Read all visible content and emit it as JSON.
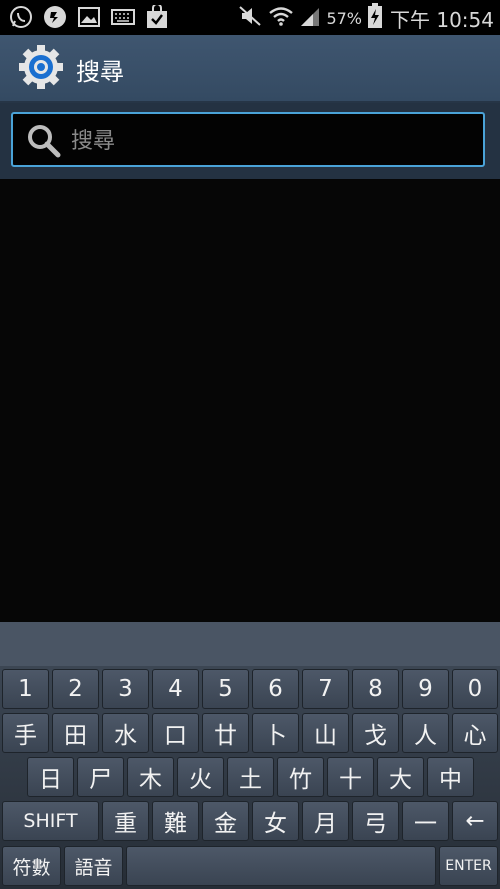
{
  "status_bar": {
    "icons": [
      "whatsapp-icon",
      "sync-icon",
      "gallery-icon",
      "keyboard-icon",
      "store-bag-icon"
    ],
    "right_icons": [
      "mute-icon",
      "wifi-icon",
      "signal-icon",
      "battery-charging-icon"
    ],
    "battery_percent": "57%",
    "time": "下午 10:54"
  },
  "action_bar": {
    "icon": "settings-gear-icon",
    "title": "搜尋"
  },
  "search": {
    "placeholder": "搜尋",
    "value": "",
    "icon": "search-icon"
  },
  "keyboard": {
    "row_numbers": [
      "1",
      "2",
      "3",
      "4",
      "5",
      "6",
      "7",
      "8",
      "9",
      "0"
    ],
    "row_1": [
      "手",
      "田",
      "水",
      "口",
      "廿",
      "卜",
      "山",
      "戈",
      "人",
      "心"
    ],
    "row_2": [
      "日",
      "尸",
      "木",
      "火",
      "土",
      "竹",
      "十",
      "大",
      "中"
    ],
    "row_3": [
      "SHIFT",
      "重",
      "難",
      "金",
      "女",
      "月",
      "弓",
      "一",
      "←"
    ],
    "row_4": [
      "符數",
      "語音",
      "",
      "ENTER"
    ],
    "colors": {
      "key": "#3f4957",
      "text": "#f2f2f2",
      "accent": "#4aa3d8"
    }
  }
}
